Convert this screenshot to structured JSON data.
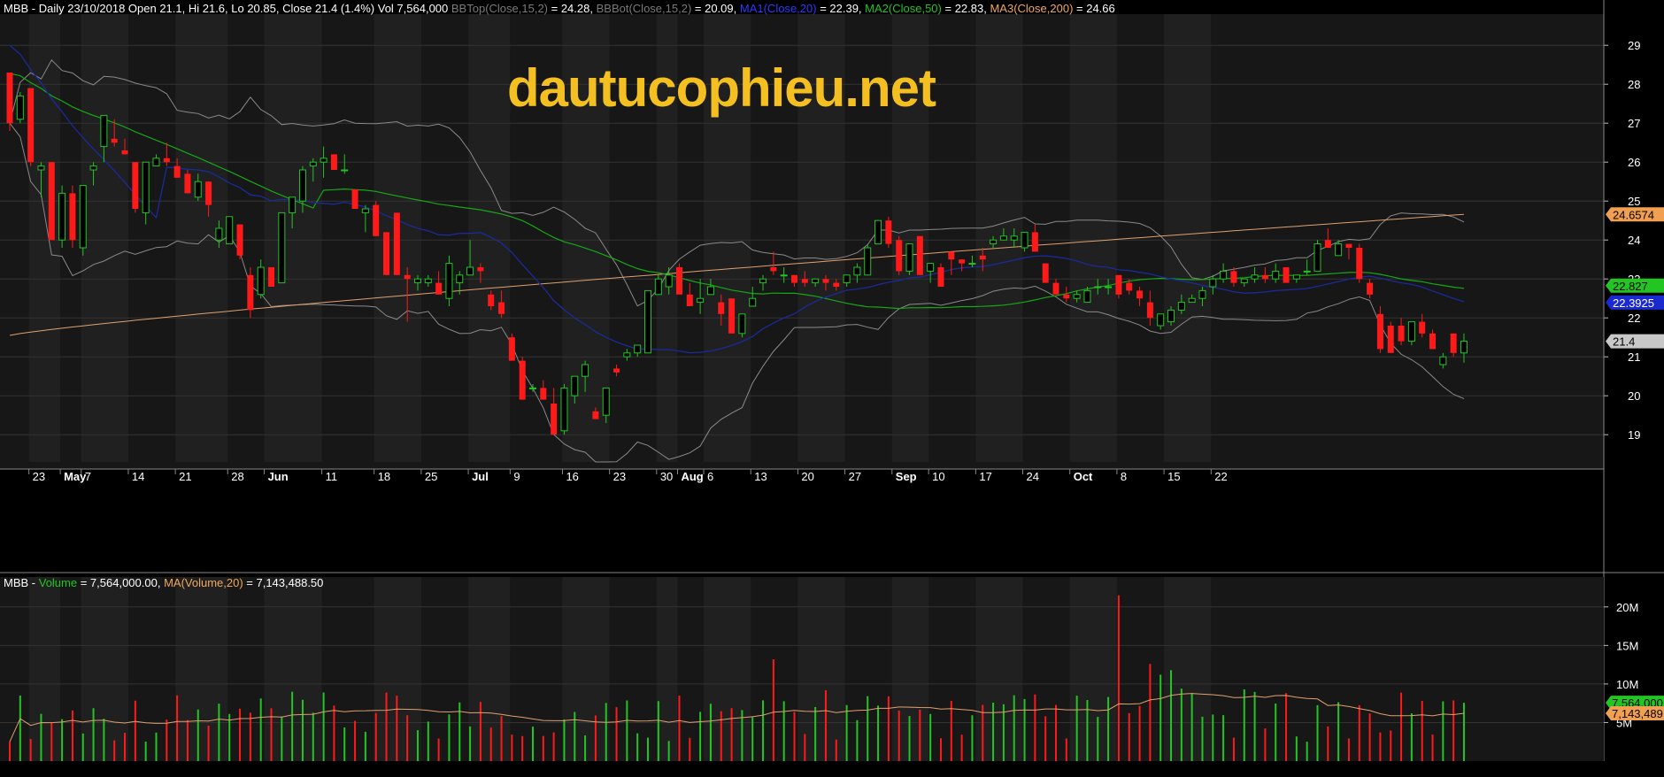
{
  "header": {
    "ticker": "MBB",
    "text": "MBB - Daily 23/10/2018 Open 21.1, Hi 21.6, Lo 20.85, Close 21.4 (1.4%) Vol 7,564,000",
    "bbtop": "BBTop(Close,15,2)",
    "bbtop_val": " = 24.28,",
    "bbbot": "BBBot(Close,15,2)",
    "bbbot_val": " = 20.09,",
    "ma1": "MA1(Close,20)",
    "ma1_val": " = 22.39,",
    "ma2": "MA2(Close,50)",
    "ma2_val": " = 22.83,",
    "ma3": "MA3(Close,200)",
    "ma3_val": " = 24.66"
  },
  "volume_header": {
    "prefix": "MBB - ",
    "vol_label": "Volume",
    "vol_val": " = 7,564,000.00,",
    "ma_label": "MA(Volume,20)",
    "ma_val": " = 7,143,488.50"
  },
  "watermark": "dautucophieu.net",
  "colors": {
    "background": "#000000",
    "panel": "#1a1a1a",
    "up": "#22c522",
    "down": "#ff1a1a",
    "ma20": "#1a2a9a",
    "ma50": "#15a915",
    "ma200": "#e0a070",
    "bands": "#8a8a8a",
    "watermark": "#f4c021"
  },
  "chart_data": [
    {
      "type": "candlestick",
      "title": "MBB - Daily 23/10/2018",
      "ylim": [
        18.3,
        29.8
      ],
      "y_ticks": [
        19,
        20,
        21,
        22,
        23,
        24,
        25,
        26,
        27,
        28,
        29
      ],
      "x_labels": [
        {
          "label": "23",
          "i": 2,
          "bold": false
        },
        {
          "label": "May",
          "i": 5,
          "bold": true
        },
        {
          "label": "7",
          "i": 7,
          "bold": false
        },
        {
          "label": "14",
          "i": 11.5,
          "bold": false
        },
        {
          "label": "21",
          "i": 16,
          "bold": false
        },
        {
          "label": "28",
          "i": 21,
          "bold": false
        },
        {
          "label": "Jun",
          "i": 24.5,
          "bold": true
        },
        {
          "label": "11",
          "i": 30,
          "bold": false
        },
        {
          "label": "18",
          "i": 35,
          "bold": false
        },
        {
          "label": "25",
          "i": 39.5,
          "bold": false
        },
        {
          "label": "Jul",
          "i": 44,
          "bold": true
        },
        {
          "label": "9",
          "i": 48,
          "bold": false
        },
        {
          "label": "16",
          "i": 53,
          "bold": false
        },
        {
          "label": "23",
          "i": 57.5,
          "bold": false
        },
        {
          "label": "30",
          "i": 62,
          "bold": false
        },
        {
          "label": "Aug",
          "i": 64,
          "bold": true
        },
        {
          "label": "6",
          "i": 66.5,
          "bold": false
        },
        {
          "label": "13",
          "i": 71,
          "bold": false
        },
        {
          "label": "20",
          "i": 75.5,
          "bold": false
        },
        {
          "label": "27",
          "i": 80,
          "bold": false
        },
        {
          "label": "Sep",
          "i": 84.5,
          "bold": true
        },
        {
          "label": "10",
          "i": 88,
          "bold": false
        },
        {
          "label": "17",
          "i": 92.5,
          "bold": false
        },
        {
          "label": "24",
          "i": 97,
          "bold": false
        },
        {
          "label": "Oct",
          "i": 101.5,
          "bold": true
        },
        {
          "label": "8",
          "i": 106,
          "bold": false
        },
        {
          "label": "15",
          "i": 110.5,
          "bold": false
        },
        {
          "label": "22",
          "i": 115,
          "bold": false
        }
      ],
      "candles": [
        [
          28.3,
          28.3,
          26.8,
          27.0
        ],
        [
          27.1,
          27.8,
          27.0,
          27.7
        ],
        [
          27.9,
          27.9,
          25.9,
          26.0
        ],
        [
          25.8,
          26.0,
          25.1,
          25.9
        ],
        [
          26.0,
          26.0,
          24.0,
          24.0
        ],
        [
          24.0,
          25.4,
          23.8,
          25.2
        ],
        [
          25.2,
          25.4,
          23.8,
          24.0
        ],
        [
          23.8,
          25.4,
          23.6,
          25.4
        ],
        [
          25.8,
          26.0,
          25.4,
          25.9
        ],
        [
          26.4,
          27.2,
          26.0,
          27.2
        ],
        [
          26.6,
          27.1,
          26.4,
          26.5
        ],
        [
          26.3,
          26.6,
          26.2,
          26.2
        ],
        [
          26.0,
          26.0,
          24.7,
          24.8
        ],
        [
          24.7,
          26.0,
          24.4,
          26.0
        ],
        [
          25.9,
          26.2,
          25.9,
          26.1
        ],
        [
          26.1,
          26.5,
          25.9,
          26.0
        ],
        [
          25.9,
          26.1,
          25.6,
          25.6
        ],
        [
          25.7,
          25.8,
          25.2,
          25.2
        ],
        [
          25.1,
          25.7,
          25.0,
          25.5
        ],
        [
          25.5,
          25.5,
          24.6,
          24.9
        ],
        [
          24.0,
          24.5,
          23.8,
          24.3
        ],
        [
          23.9,
          24.6,
          23.9,
          24.6
        ],
        [
          24.4,
          24.4,
          23.5,
          23.6
        ],
        [
          23.1,
          23.3,
          22.0,
          22.2
        ],
        [
          22.6,
          23.5,
          22.5,
          23.3
        ],
        [
          23.3,
          23.3,
          22.8,
          22.8
        ],
        [
          22.9,
          24.7,
          22.9,
          24.7
        ],
        [
          24.7,
          25.1,
          24.3,
          25.1
        ],
        [
          25.0,
          25.9,
          24.7,
          25.8
        ],
        [
          25.9,
          26.1,
          25.5,
          26.0
        ],
        [
          26.0,
          26.4,
          25.6,
          26.1
        ],
        [
          26.2,
          26.2,
          25.8,
          25.8
        ],
        [
          25.8,
          26.2,
          25.7,
          25.8
        ],
        [
          25.3,
          25.3,
          24.8,
          24.8
        ],
        [
          24.7,
          24.9,
          24.2,
          24.8
        ],
        [
          24.9,
          25.0,
          24.1,
          24.1
        ],
        [
          24.2,
          24.2,
          23.1,
          23.1
        ],
        [
          24.7,
          24.7,
          23.1,
          23.1
        ],
        [
          23.1,
          23.3,
          21.9,
          23.0
        ],
        [
          22.9,
          23.1,
          22.7,
          23.0
        ],
        [
          22.9,
          23.1,
          22.8,
          23.0
        ],
        [
          22.9,
          23.2,
          22.6,
          22.6
        ],
        [
          22.5,
          23.6,
          22.3,
          23.4
        ],
        [
          22.9,
          23.2,
          22.6,
          23.1
        ],
        [
          23.1,
          24.0,
          23.1,
          23.3
        ],
        [
          23.3,
          23.4,
          22.9,
          23.2
        ],
        [
          22.6,
          22.7,
          22.2,
          22.3
        ],
        [
          22.4,
          22.7,
          22.0,
          22.1
        ],
        [
          21.5,
          21.6,
          20.9,
          20.9
        ],
        [
          20.9,
          21.0,
          19.9,
          19.9
        ],
        [
          20.2,
          20.3,
          20.1,
          20.2
        ],
        [
          20.2,
          20.4,
          19.9,
          19.9
        ],
        [
          19.8,
          20.2,
          19.1,
          19.0
        ],
        [
          19.1,
          20.3,
          19.0,
          20.2
        ],
        [
          20.0,
          20.5,
          19.8,
          20.5
        ],
        [
          20.5,
          20.9,
          20.1,
          20.8
        ],
        [
          19.6,
          19.7,
          19.4,
          19.4
        ],
        [
          19.5,
          20.2,
          19.3,
          20.2
        ],
        [
          20.7,
          20.8,
          20.5,
          20.6
        ],
        [
          21.0,
          21.2,
          20.9,
          21.1
        ],
        [
          21.1,
          21.3,
          21.0,
          21.3
        ],
        [
          21.1,
          22.7,
          21.1,
          22.7
        ],
        [
          22.6,
          23.1,
          22.6,
          23.0
        ],
        [
          22.8,
          23.3,
          22.6,
          23.1
        ],
        [
          23.3,
          23.4,
          22.7,
          22.6
        ],
        [
          22.6,
          22.9,
          22.3,
          22.3
        ],
        [
          22.4,
          23.0,
          22.1,
          22.5
        ],
        [
          22.6,
          23.0,
          22.6,
          22.8
        ],
        [
          22.4,
          22.6,
          21.8,
          22.1
        ],
        [
          22.5,
          22.5,
          21.6,
          21.6
        ],
        [
          21.6,
          22.1,
          21.5,
          22.1
        ],
        [
          22.3,
          22.8,
          22.3,
          22.5
        ],
        [
          22.9,
          23.1,
          22.7,
          23.0
        ],
        [
          23.3,
          23.7,
          23.1,
          23.2
        ],
        [
          23.1,
          23.3,
          22.9,
          23.1
        ],
        [
          23.1,
          23.1,
          22.8,
          22.9
        ],
        [
          23.0,
          23.2,
          22.8,
          22.9
        ],
        [
          22.9,
          23.0,
          22.8,
          23.0
        ],
        [
          23.0,
          23.1,
          22.7,
          22.9
        ],
        [
          22.9,
          23.0,
          22.7,
          22.8
        ],
        [
          22.9,
          23.1,
          22.8,
          23.1
        ],
        [
          23.1,
          23.4,
          22.9,
          23.3
        ],
        [
          23.1,
          23.9,
          23.1,
          23.8
        ],
        [
          23.9,
          24.5,
          23.9,
          24.5
        ],
        [
          24.5,
          24.6,
          23.8,
          23.9
        ],
        [
          24.0,
          24.1,
          23.1,
          23.2
        ],
        [
          23.2,
          23.8,
          23.1,
          23.9
        ],
        [
          24.1,
          24.1,
          23.1,
          23.1
        ],
        [
          23.2,
          23.4,
          22.9,
          23.4
        ],
        [
          23.3,
          23.4,
          22.8,
          22.8
        ],
        [
          23.7,
          23.7,
          23.1,
          23.5
        ],
        [
          23.5,
          23.5,
          23.2,
          23.4
        ],
        [
          23.4,
          23.6,
          23.3,
          23.4
        ],
        [
          23.6,
          23.8,
          23.2,
          23.5
        ],
        [
          23.9,
          24.1,
          23.8,
          24.0
        ],
        [
          24.0,
          24.3,
          24.0,
          24.1
        ],
        [
          24.0,
          24.3,
          23.8,
          24.1
        ],
        [
          23.8,
          24.2,
          23.7,
          24.2
        ],
        [
          24.2,
          24.4,
          23.7,
          23.7
        ],
        [
          23.4,
          23.4,
          22.9,
          22.9
        ],
        [
          22.9,
          23.0,
          22.6,
          22.6
        ],
        [
          22.6,
          22.8,
          22.4,
          22.5
        ],
        [
          22.5,
          22.7,
          22.4,
          22.6
        ],
        [
          22.4,
          22.8,
          22.4,
          22.7
        ],
        [
          22.8,
          23.0,
          22.6,
          22.8
        ],
        [
          22.8,
          23.0,
          22.6,
          22.8
        ],
        [
          23.1,
          23.1,
          22.5,
          22.6
        ],
        [
          22.9,
          23.0,
          22.6,
          22.7
        ],
        [
          22.7,
          22.8,
          22.3,
          22.5
        ],
        [
          22.4,
          22.7,
          21.8,
          22.0
        ],
        [
          21.8,
          22.1,
          21.7,
          22.1
        ],
        [
          21.9,
          22.3,
          21.8,
          22.2
        ],
        [
          22.2,
          22.6,
          22.1,
          22.4
        ],
        [
          22.4,
          22.6,
          22.4,
          22.5
        ],
        [
          22.5,
          22.8,
          22.3,
          22.7
        ],
        [
          22.8,
          23.1,
          22.6,
          23.0
        ],
        [
          23.0,
          23.4,
          22.9,
          23.2
        ],
        [
          23.2,
          23.3,
          22.8,
          22.9
        ],
        [
          22.9,
          23.0,
          22.8,
          23.0
        ],
        [
          23.0,
          23.3,
          22.9,
          23.1
        ],
        [
          23.1,
          23.3,
          22.9,
          23.0
        ],
        [
          23.0,
          23.4,
          22.9,
          23.2
        ],
        [
          23.3,
          23.3,
          22.9,
          22.9
        ],
        [
          23.0,
          23.1,
          22.9,
          23.1
        ],
        [
          23.2,
          23.5,
          23.1,
          23.2
        ],
        [
          23.2,
          24.0,
          23.2,
          23.9
        ],
        [
          24.0,
          24.3,
          23.9,
          23.8
        ],
        [
          23.6,
          24.0,
          23.6,
          23.9
        ],
        [
          23.9,
          23.9,
          23.5,
          23.8
        ],
        [
          23.8,
          23.9,
          22.9,
          23.0
        ],
        [
          22.9,
          23.0,
          22.5,
          22.6
        ],
        [
          22.1,
          22.3,
          21.1,
          21.2
        ],
        [
          21.8,
          21.9,
          21.1,
          21.1
        ],
        [
          21.8,
          22.0,
          21.3,
          21.4
        ],
        [
          21.4,
          21.9,
          21.3,
          21.9
        ],
        [
          21.9,
          22.1,
          21.5,
          21.6
        ],
        [
          21.6,
          21.7,
          21.2,
          21.2
        ],
        [
          20.8,
          21.1,
          20.7,
          21.0
        ],
        [
          21.6,
          21.6,
          21.0,
          21.1
        ],
        [
          21.1,
          21.6,
          20.85,
          21.4
        ]
      ],
      "series": [
        {
          "name": "BBTop(Close,15,2)",
          "value": 24.28
        },
        {
          "name": "BBBot(Close,15,2)",
          "value": 20.09
        },
        {
          "name": "MA1(Close,20)",
          "value": 22.39
        },
        {
          "name": "MA2(Close,50)",
          "value": 22.83
        },
        {
          "name": "MA3(Close,200)",
          "value": 24.66
        }
      ],
      "value_tags": [
        {
          "label": "24.6574",
          "value": 24.6574,
          "color": "#f0a050",
          "text": "#000"
        },
        {
          "label": "22.827",
          "value": 22.827,
          "color": "#22c522",
          "text": "#000"
        },
        {
          "label": "22.3925",
          "value": 22.3925,
          "color": "#1a2acf",
          "text": "#fff"
        },
        {
          "label": "21.4",
          "value": 21.4,
          "color": "#c8c8c8",
          "text": "#000"
        }
      ]
    },
    {
      "type": "bar",
      "title": "Volume",
      "ylim": [
        0,
        22.5
      ],
      "y_ticks": [
        {
          "label": "5M",
          "v": 5
        },
        {
          "label": "10M",
          "v": 10
        },
        {
          "label": "15M",
          "v": 15
        },
        {
          "label": "20M",
          "v": 20
        }
      ],
      "value_tags": [
        {
          "label": "7,564,000",
          "value": 7.564,
          "color": "#22c522",
          "text": "#000"
        },
        {
          "label": "7,143,489",
          "value": 6.2,
          "color": "#f0a050",
          "text": "#000"
        }
      ],
      "ma_volume_last": 7.143
    }
  ]
}
